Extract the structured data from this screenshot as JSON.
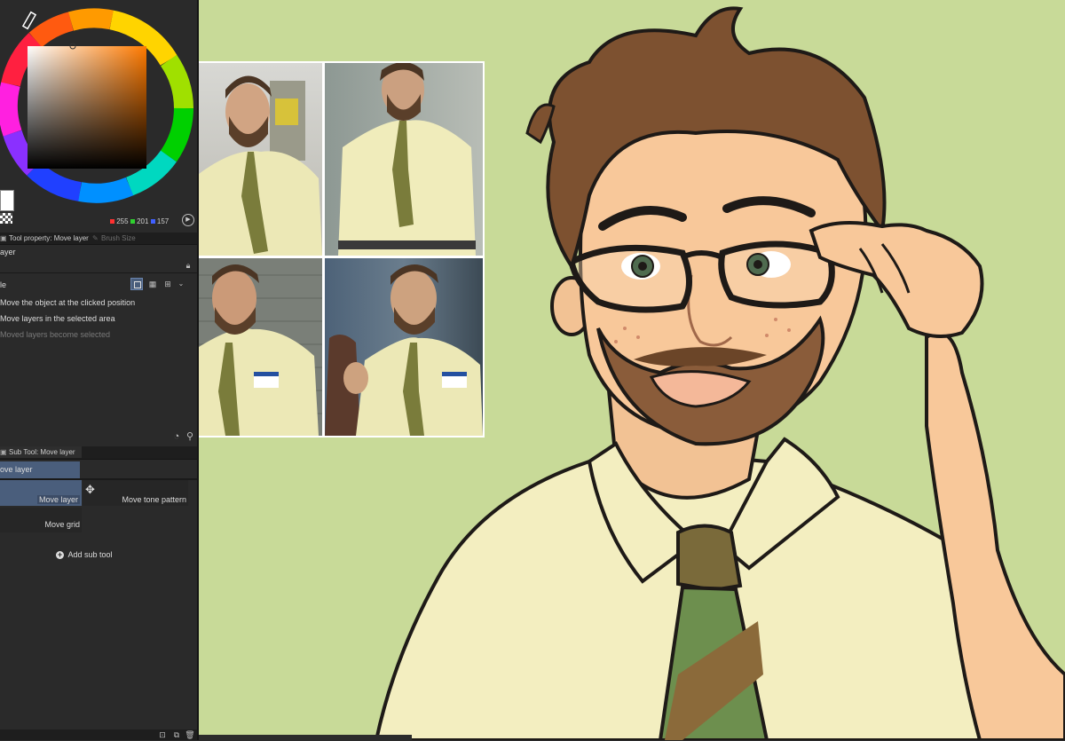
{
  "colors": {
    "panel_bg": "#2a2a2a",
    "canvas_bg": "#c8da98",
    "selected": "#4a5e7c",
    "rgb_r": "#ff3030",
    "rgb_g": "#2fd02f",
    "rgb_b": "#4060ff"
  },
  "color_panel": {
    "r_value": "255",
    "g_value": "201",
    "b_value": "157"
  },
  "tabs": {
    "tool_property": "Tool property: Move layer",
    "brush_size": "Brush Size"
  },
  "tool_property": {
    "header": "ayer",
    "mode_label": "le",
    "options": [
      "Move the object at the clicked position",
      "Move layers in the selected area",
      "Moved layers become selected"
    ]
  },
  "sub_tool": {
    "tab_label": "Sub Tool: Move layer",
    "group_label": "ove layer",
    "items": [
      "Move layer",
      "Move tone pattern",
      "Move grid"
    ],
    "add_label": "Add sub tool"
  },
  "icons": [
    "lock-icon",
    "rect-mode-icon",
    "checker-mode-icon",
    "grid-mode-icon",
    "settings-clock-icon",
    "wrench-icon",
    "move-arrows-icon",
    "add-circle-icon",
    "transparent-swatch-icon",
    "color-mode-icon",
    "trash-icon"
  ]
}
